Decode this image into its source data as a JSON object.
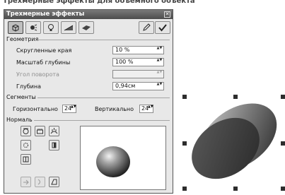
{
  "background": {
    "caption_text": "Трехмерные эффекты для объемного объекта"
  },
  "dialog": {
    "title": "Трехмерные эффекты",
    "close_glyph": "✕",
    "toolbar": {
      "buttons": [
        {
          "name": "geometry",
          "icon": "cube-icon",
          "glyph": "⬚",
          "active": true
        },
        {
          "name": "shading",
          "icon": "light-icon",
          "glyph": "✱",
          "active": false
        },
        {
          "name": "illumination",
          "icon": "bulb-icon",
          "glyph": "♁",
          "active": false
        },
        {
          "name": "textures",
          "icon": "texture-icon",
          "glyph": "◢",
          "active": false
        },
        {
          "name": "material",
          "icon": "material-icon",
          "glyph": "◆",
          "active": false
        }
      ],
      "right_buttons": [
        {
          "name": "assign",
          "icon": "pen-icon",
          "glyph": "✎"
        },
        {
          "name": "apply",
          "icon": "checkmark-icon",
          "glyph": "✔"
        }
      ]
    },
    "geometry": {
      "title": "Геометрия",
      "rounded_edges_label": "Скругленные края",
      "rounded_edges_value": "10 %",
      "depth_scale_label": "Масштаб глубины",
      "depth_scale_value": "100 %",
      "rotation_angle_label": "Угол поворота",
      "rotation_angle_value": "",
      "depth_label": "Глубина",
      "depth_value": "0,94см"
    },
    "segments": {
      "title": "Сегменты",
      "horizontal_label": "Горизонтально",
      "horizontal_value": "24",
      "vertical_label": "Вертикально",
      "vertical_value": "24"
    },
    "normal": {
      "title": "Нормаль",
      "spinner_arrows": "▲▼"
    }
  },
  "colors": {
    "title_bar": "#5a5a5a",
    "dialog_bg": "#e8e8e8",
    "shape_dark": "#3a3a3a"
  }
}
